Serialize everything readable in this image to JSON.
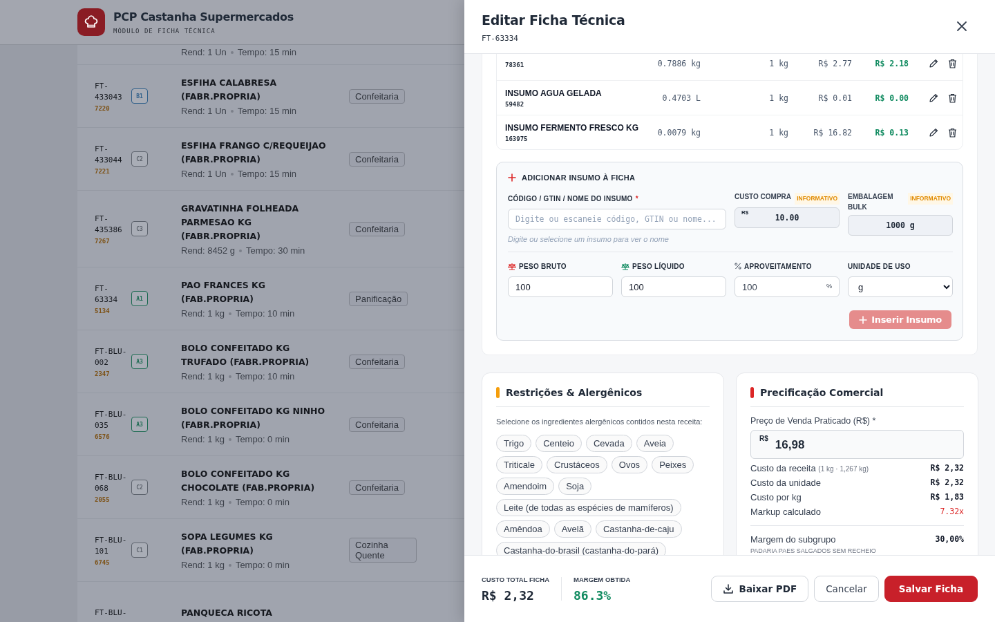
{
  "app": {
    "title": "PCP Castanha Supermercados",
    "subtitle": "MÓDULO DE FICHA TÉCNICA"
  },
  "recipes_partial_top": {
    "yield": "Rend: 1 Un",
    "time": "Tempo: 15 min"
  },
  "recipes": [
    {
      "code": "FT-433043",
      "id": "7220",
      "class": "B1",
      "color": "#2f5f8a",
      "name": "ESFIHA CALABRESA (FABR.PROPRIA)",
      "yield": "Rend: 1 Un",
      "time": "Tempo: 15 min",
      "category": "Confeitaria"
    },
    {
      "code": "FT-433044",
      "id": "7221",
      "class": "C2",
      "color": "#5d636d",
      "name": "ESFIHA FRANGO C/REQUEIJAO (FABR.PROPRIA)",
      "yield": "Rend: 1 Un",
      "time": "Tempo: 15 min",
      "category": "Confeitaria"
    },
    {
      "code": "FT-435386",
      "id": "7267",
      "class": "C3",
      "color": "#5d636d",
      "name": "GRAVATINHA FOLHEADA PARMESAO KG (FABR.PROPRIA)",
      "yield": "Rend: 8452 g",
      "time": "Tempo: 30 min",
      "category": "Confeitaria"
    },
    {
      "code": "FT-63334",
      "id": "5134",
      "class": "A1",
      "color": "#1d6a52",
      "name": "PAO FRANCES KG (FAB.PROPRIA)",
      "yield": "Rend: 1 kg",
      "time": "Tempo: 10 min",
      "category": "Panificação"
    },
    {
      "code": "FT-BLU-002",
      "id": "2347",
      "class": "A3",
      "color": "#1d6a52",
      "name": "BOLO CONFEITADO KG TRUFADO (FABR.PROPRIA)",
      "yield": "Rend: 1 kg",
      "time": "Tempo: 10 min",
      "category": "Confeitaria"
    },
    {
      "code": "FT-BLU-035",
      "id": "6576",
      "class": "A3",
      "color": "#1d6a52",
      "name": "BOLO CONFEITADO KG NINHO (FABR.PROPRIA)",
      "yield": "Rend: 1 kg",
      "time": "Tempo: 0 min",
      "category": "Confeitaria"
    },
    {
      "code": "FT-BLU-068",
      "id": "2055",
      "class": "C2",
      "color": "#5d636d",
      "name": "BOLO CONFEITADO KG CHOCOLATE (FAB.PROPRIA)",
      "yield": "Rend: 1 kg",
      "time": "Tempo: 0 min",
      "category": "Confeitaria"
    },
    {
      "code": "FT-BLU-101",
      "id": "6745",
      "class": "C1",
      "color": "#5d636d",
      "name": "SOPA LEGUMES KG (FAB.PROPRIA)",
      "yield": "Rend: 1 kg",
      "time": "Tempo: 0 min",
      "category": "Cozinha Quente"
    }
  ],
  "recipes_partial_bottom": {
    "code": "FT-BLU-",
    "name": "PANQUECA RICOTA"
  },
  "drawer": {
    "title": "Editar Ficha Técnica",
    "code": "FT-63334"
  },
  "ingredients": [
    {
      "code": "78361",
      "qty": "0.7886 kg",
      "unit": "1 kg",
      "cost": "R$ 2.77",
      "total": "R$ 2.18"
    },
    {
      "name": "INSUMO AGUA GELADA",
      "code": "59482",
      "qty": "0.4703 L",
      "unit": "1 kg",
      "cost": "R$ 0.01",
      "total": "R$ 0.00"
    },
    {
      "name": "INSUMO FERMENTO FRESCO KG",
      "code": "163975",
      "qty": "0.0079 kg",
      "unit": "1 kg",
      "cost": "R$ 16.82",
      "total": "R$ 0.13"
    }
  ],
  "add_form": {
    "title": "ADICIONAR INSUMO À FICHA",
    "search": {
      "label": "CÓDIGO / GTIN / NOME DO INSUMO",
      "required_mark": "*",
      "placeholder": "Digite ou escaneie código, GTIN ou nome...",
      "hint": "Digite ou selecione um insumo para ver o nome"
    },
    "cost": {
      "label": "CUSTO COMPRA",
      "badge": "INFORMATIVO",
      "prefix": "R$",
      "value": "10.00"
    },
    "pack": {
      "label": "EMBALAGEM BULK",
      "badge": "INFORMATIVO",
      "value": "1000 g"
    },
    "gross": {
      "label": "PESO BRUTO",
      "value": "100"
    },
    "net": {
      "label": "PESO LÍQUIDO",
      "value": "100"
    },
    "yield": {
      "label": "APROVEITAMENTO",
      "value": "100",
      "suffix": "%"
    },
    "unit": {
      "label": "UNIDADE DE USO",
      "value": "g"
    },
    "insert_button": {
      "label": "Inserir Insumo",
      "disabled": true
    }
  },
  "allergens": {
    "title": "Restrições & Alergênicos",
    "intro": "Selecione os ingredientes alergênicos contidos nesta receita:",
    "items": [
      {
        "label": "Trigo",
        "selected": false
      },
      {
        "label": "Centeio",
        "selected": false
      },
      {
        "label": "Cevada",
        "selected": false
      },
      {
        "label": "Aveia",
        "selected": false
      },
      {
        "label": "Triticale",
        "selected": false
      },
      {
        "label": "Crustáceos",
        "selected": false
      },
      {
        "label": "Ovos",
        "selected": false
      },
      {
        "label": "Peixes",
        "selected": false
      },
      {
        "label": "Amendoim",
        "selected": false
      },
      {
        "label": "Soja",
        "selected": false
      },
      {
        "label": "Leite (de todas as espécies de mamíferos)",
        "selected": false
      },
      {
        "label": "Amêndoa",
        "selected": false
      },
      {
        "label": "Avelã",
        "selected": false
      },
      {
        "label": "Castanha-de-caju",
        "selected": false
      },
      {
        "label": "Castanha-do-brasil (castanha-do-pará)",
        "selected": false
      }
    ]
  },
  "pricing": {
    "title": "Precificação Comercial",
    "price_label": "Preço de Venda Praticado (R$) *",
    "currency": "R$",
    "price": "16,98",
    "rows": [
      {
        "label": "Custo da receita",
        "note": "(1 kg · 1,267 kg)",
        "value": "R$ 2,32",
        "kind": "normal"
      },
      {
        "label": "Custo da unidade",
        "value": "R$ 2,32",
        "kind": "normal"
      },
      {
        "label": "Custo por kg",
        "value": "R$ 1,83",
        "kind": "normal"
      },
      {
        "label": "Markup calculado",
        "value": "7.32x",
        "kind": "alert"
      }
    ],
    "margin": {
      "label": "Margem do subgrupo",
      "sub": "PADARIA PAES SALGADOS SEM RECHEIO",
      "value": "30,00%"
    }
  },
  "footer": {
    "total": {
      "label": "CUSTO TOTAL FICHA",
      "value": "R$ 2,32"
    },
    "margin": {
      "label": "MARGEM OBTIDA",
      "value": "86.3%"
    },
    "buttons": [
      {
        "label": "Baixar PDF",
        "kind": "download"
      },
      {
        "label": "Cancelar",
        "kind": "secondary"
      },
      {
        "label": "Salvar Ficha",
        "kind": "primary"
      }
    ]
  }
}
